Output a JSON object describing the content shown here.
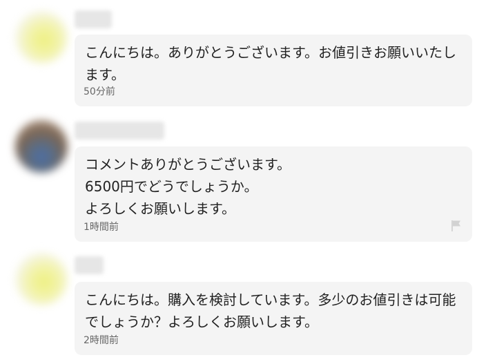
{
  "comments": [
    {
      "text": "こんにちは。ありがとうございます。お値引きお願いいたします。",
      "time": "50分前",
      "avatar_icon": "blurred-avatar-yellow"
    },
    {
      "text": "コメントありがとうございます。\n6500円でどうでしょうか。\nよろしくお願いします。",
      "time": "1時間前",
      "avatar_icon": "blurred-avatar-photo",
      "report_icon": "flag-icon"
    },
    {
      "text": "こんにちは。購入を検討しています。多少のお値引きは可能でしょうか？よろしくお願いします。",
      "time": "2時間前",
      "avatar_icon": "blurred-avatar-yellow"
    }
  ]
}
